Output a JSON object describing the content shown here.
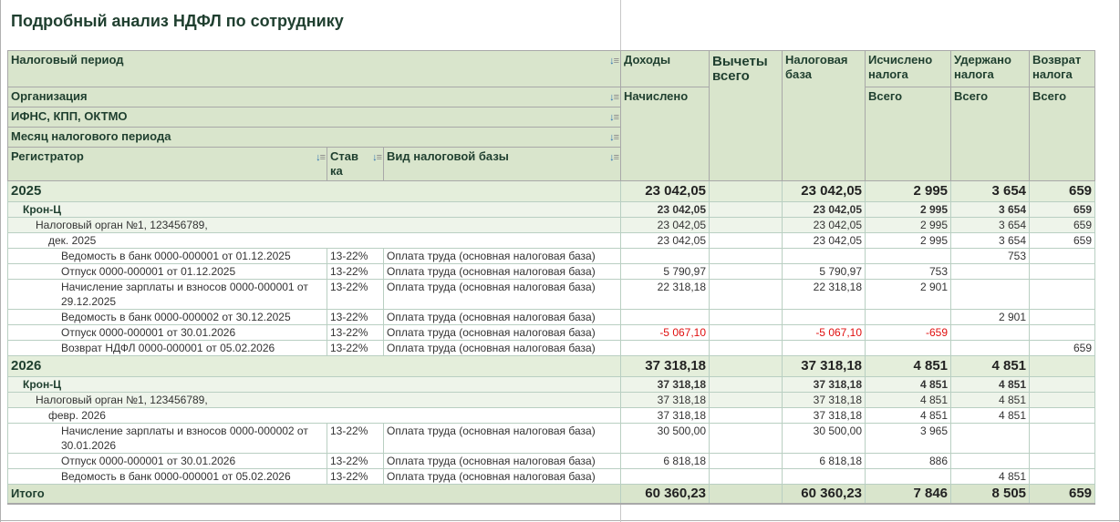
{
  "title": "Подробный анализ НДФЛ по сотруднику",
  "colors": {
    "header_bg": "#d9e5cc",
    "year_bg": "#e4eedb",
    "group_bg": "#eef4ea",
    "negative": "#e01010",
    "title": "#1f3f2f"
  },
  "header": {
    "tax_period": "Налоговый период",
    "organization": "Организация",
    "ifns": "ИФНС, КПП, ОКТМО",
    "month": "Месяц налогового периода",
    "registrar": "Регистратор",
    "rate": "Ставка",
    "base_type": "Вид налоговой базы",
    "income": "Доходы",
    "income_sub": "Начислено",
    "deductions": "Вычеты всего",
    "tax_base": "Налоговая база",
    "calculated": "Исчислено налога",
    "calculated_sub": "Всего",
    "withheld": "Удержано налога",
    "withheld_sub": "Всего",
    "refund": "Возврат налога",
    "refund_sub": "Всего",
    "sort_icon": "sort-icon"
  },
  "rows": [
    {
      "level": "year",
      "name": "2025",
      "v": [
        "23 042,05",
        "",
        "23 042,05",
        "2 995",
        "3 654",
        "659"
      ]
    },
    {
      "level": "org",
      "name": "Крон-Ц",
      "v": [
        "23 042,05",
        "",
        "23 042,05",
        "2 995",
        "3 654",
        "659"
      ]
    },
    {
      "level": "ifns",
      "name": "Налоговый орган №1, 123456789,",
      "v": [
        "23 042,05",
        "",
        "23 042,05",
        "2 995",
        "3 654",
        "659"
      ]
    },
    {
      "level": "month",
      "name": "дек. 2025",
      "v": [
        "23 042,05",
        "",
        "23 042,05",
        "2 995",
        "3 654",
        "659"
      ]
    },
    {
      "level": "doc",
      "name": "Ведомость в банк 0000-000001 от 01.12.2025",
      "rate": "13-22%",
      "base": "Оплата труда (основная налоговая база)",
      "v": [
        "",
        "",
        "",
        "",
        "753",
        ""
      ]
    },
    {
      "level": "doc",
      "name": "Отпуск 0000-000001 от 01.12.2025",
      "rate": "13-22%",
      "base": "Оплата труда (основная налоговая база)",
      "v": [
        "5 790,97",
        "",
        "5 790,97",
        "753",
        "",
        ""
      ]
    },
    {
      "level": "doc",
      "name": "Начисление зарплаты и взносов 0000-000001 от 29.12.2025",
      "rate": "13-22%",
      "base": "Оплата труда (основная налоговая база)",
      "v": [
        "22 318,18",
        "",
        "22 318,18",
        "2 901",
        "",
        ""
      ]
    },
    {
      "level": "doc",
      "name": "Ведомость в банк 0000-000002 от 30.12.2025",
      "rate": "13-22%",
      "base": "Оплата труда (основная налоговая база)",
      "v": [
        "",
        "",
        "",
        "",
        "2 901",
        ""
      ]
    },
    {
      "level": "doc",
      "name": "Отпуск 0000-000001 от 30.01.2026",
      "rate": "13-22%",
      "base": "Оплата труда (основная налоговая база)",
      "v": [
        "-5 067,10",
        "",
        "-5 067,10",
        "-659",
        "",
        ""
      ]
    },
    {
      "level": "doc",
      "name": "Возврат НДФЛ 0000-000001 от 05.02.2026",
      "rate": "13-22%",
      "base": "Оплата труда (основная налоговая база)",
      "v": [
        "",
        "",
        "",
        "",
        "",
        "659"
      ]
    },
    {
      "level": "year",
      "name": "2026",
      "v": [
        "37 318,18",
        "",
        "37 318,18",
        "4 851",
        "4 851",
        ""
      ]
    },
    {
      "level": "org",
      "name": "Крон-Ц",
      "v": [
        "37 318,18",
        "",
        "37 318,18",
        "4 851",
        "4 851",
        ""
      ]
    },
    {
      "level": "ifns",
      "name": "Налоговый орган №1, 123456789,",
      "v": [
        "37 318,18",
        "",
        "37 318,18",
        "4 851",
        "4 851",
        ""
      ]
    },
    {
      "level": "month",
      "name": "февр. 2026",
      "v": [
        "37 318,18",
        "",
        "37 318,18",
        "4 851",
        "4 851",
        ""
      ]
    },
    {
      "level": "doc",
      "name": "Начисление зарплаты и взносов 0000-000002 от 30.01.2026",
      "rate": "13-22%",
      "base": "Оплата труда (основная налоговая база)",
      "v": [
        "30 500,00",
        "",
        "30 500,00",
        "3 965",
        "",
        ""
      ]
    },
    {
      "level": "doc",
      "name": "Отпуск 0000-000001 от 30.01.2026",
      "rate": "13-22%",
      "base": "Оплата труда (основная налоговая база)",
      "v": [
        "6 818,18",
        "",
        "6 818,18",
        "886",
        "",
        ""
      ]
    },
    {
      "level": "doc",
      "name": "Ведомость в банк 0000-000001 от 05.02.2026",
      "rate": "13-22%",
      "base": "Оплата труда (основная налоговая база)",
      "v": [
        "",
        "",
        "",
        "",
        "4 851",
        ""
      ]
    },
    {
      "level": "total",
      "name": "Итого",
      "v": [
        "60 360,23",
        "",
        "60 360,23",
        "7 846",
        "8 505",
        "659"
      ]
    }
  ]
}
